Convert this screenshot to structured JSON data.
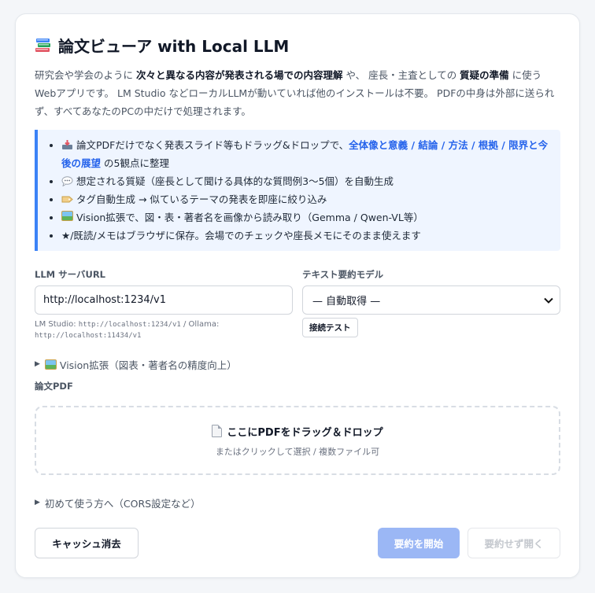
{
  "header": {
    "title": "論文ビューア with Local LLM"
  },
  "intro": {
    "p1": "研究会や学会のように ",
    "b1": "次々と異なる内容が発表される場での内容理解",
    "p2": " や、 座長・主査としての ",
    "b2": "質疑の準備",
    "p3": " に使うWebアプリです。 LM Studio などローカルLLMが動いていれば他のインストールは不要。 PDFの中身は外部に送られず、すべてあなたのPCの中だけで処理されます。"
  },
  "features": [
    {
      "t1": "論文PDFだけでなく発表スライド等もドラッグ&ドロップで、",
      "hl": "全体像と意義 / 結論 / 方法 / 根拠 / 限界と今後の展望",
      "t2": " の5観点に整理"
    },
    {
      "t1": "想定される質疑（座長として聞ける具体的な質問例3〜5個）を自動生成"
    },
    {
      "t1": "タグ自動生成 → 似ているテーマの発表を即座に絞り込み"
    },
    {
      "t1": "Vision拡張で、図・表・著者名を画像から読み取り（Gemma / Qwen-VL等）"
    },
    {
      "t1": "★/既読/メモはブラウザに保存。会場でのチェックや座長メモにそのまま使えます"
    }
  ],
  "form": {
    "url_label": "LLM サーバURL",
    "url_value": "http://localhost:1234/v1",
    "url_hint_prefix": "LM Studio: ",
    "url_hint_lm": "http://localhost:1234/v1",
    "url_hint_sep": " / Ollama:",
    "url_hint_ollama": "http://localhost:11434/v1",
    "model_label": "テキスト要約モデル",
    "model_value": "— 自動取得 —",
    "test_label": "接続テスト"
  },
  "vision": {
    "label": "Vision拡張（図表・著者名の精度向上）"
  },
  "pdf": {
    "label": "論文PDF",
    "drop_title": "ここにPDFをドラッグ＆ドロップ",
    "drop_sub": "またはクリックして選択 / 複数ファイル可"
  },
  "first_use": {
    "label": "初めて使う方へ（CORS設定など）"
  },
  "actions": {
    "clear_label": "キャッシュ消去",
    "start_label": "要約を開始",
    "open_label": "要約せず開く"
  },
  "colors": {
    "accent": "#3b82f6",
    "highlight": "#2563eb",
    "start_button": "#9bb7f5"
  }
}
